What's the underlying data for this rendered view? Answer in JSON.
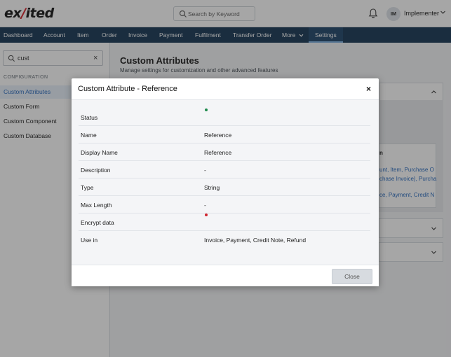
{
  "app": {
    "logo": {
      "pre": "ex",
      "slash": "/",
      "post": "ited"
    },
    "search_placeholder": "Search by Keyword",
    "user": {
      "initials": "IM",
      "name": "Implementer"
    }
  },
  "nav": {
    "items": [
      "Dashboard",
      "Account",
      "Item",
      "Order",
      "Invoice",
      "Payment",
      "Fulfilment",
      "Transfer Order",
      "More",
      "Settings"
    ],
    "active": "Settings"
  },
  "sidebar": {
    "search_value": "cust",
    "clear": "×",
    "heading": "CONFIGURATION",
    "items": [
      "Custom Attributes",
      "Custom Form",
      "Custom Component",
      "Custom Database"
    ],
    "active": "Custom Attributes"
  },
  "main": {
    "title": "Custom Attributes",
    "subtitle": "Manage settings for customization and other advanced features",
    "table_header": "n",
    "table_cells": [
      "unt, Item, Purchase O",
      "chase Invoice), Purcha",
      "ce, Payment, Credit N"
    ]
  },
  "modal": {
    "title": "Custom Attribute - Reference",
    "close_icon": "×",
    "rows": [
      {
        "label": "Status",
        "value": "",
        "dot_color": "#1e8a4c"
      },
      {
        "label": "Name",
        "value": "Reference"
      },
      {
        "label": "Display Name",
        "value": "Reference"
      },
      {
        "label": "Description",
        "value": "-"
      },
      {
        "label": "Type",
        "value": "String"
      },
      {
        "label": "Max Length",
        "value": "-"
      },
      {
        "label": "Encrypt data",
        "value": "",
        "dot_color": "#d0252f"
      },
      {
        "label": "Use in",
        "value": "Invoice, Payment, Credit Note, Refund"
      }
    ],
    "close_button": "Close"
  },
  "colors": {
    "brand_red": "#d8262f",
    "nav_bg": "#1e3d5a",
    "link_blue": "#2f6fc0"
  }
}
